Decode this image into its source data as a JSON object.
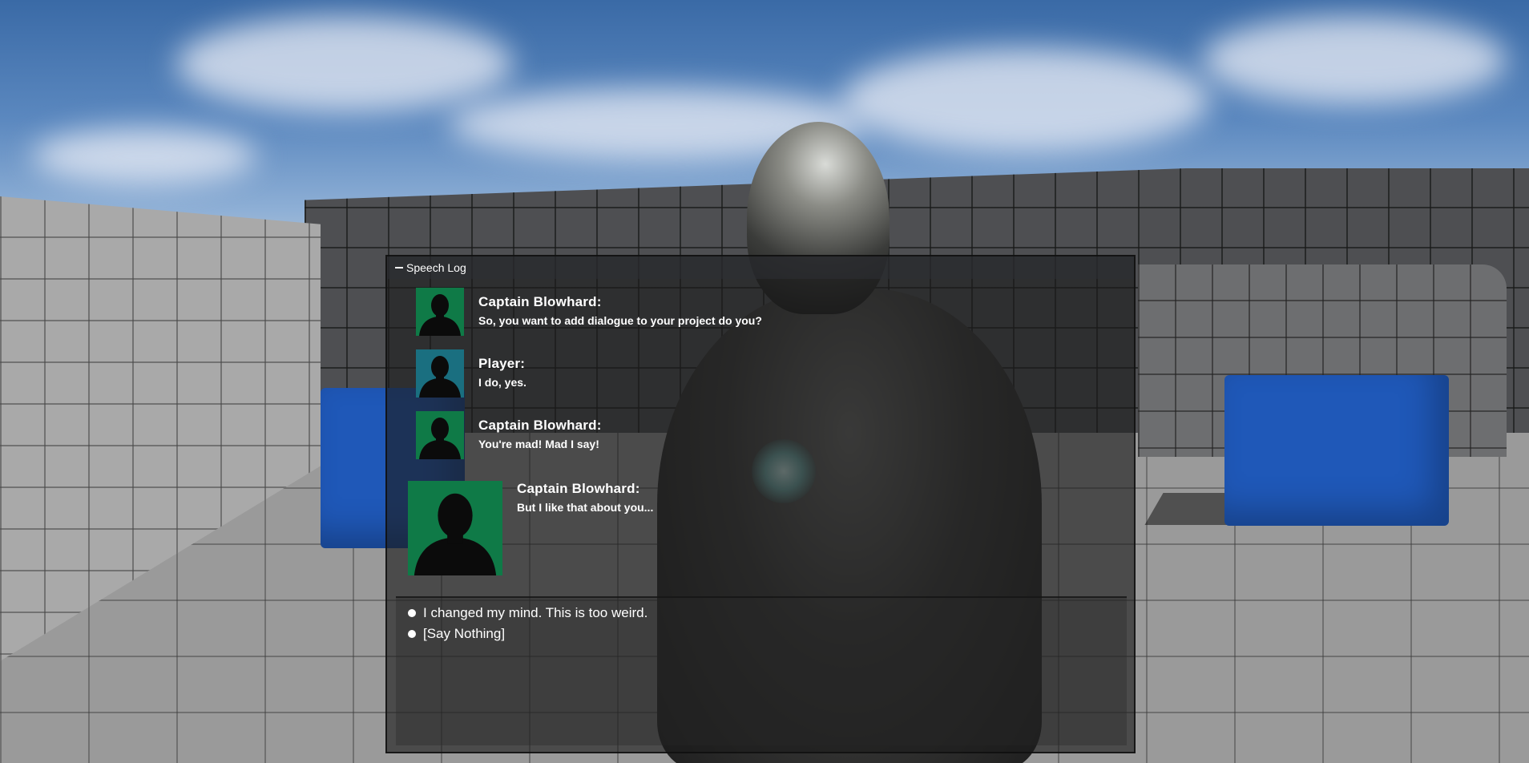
{
  "speech_log": {
    "header_label": "Speech Log",
    "entries": [
      {
        "speaker": "Captain Blowhard:",
        "line": "So, you want to add dialogue to your project do you?",
        "portrait": "silhouette-green-icon"
      },
      {
        "speaker": "Player:",
        "line": "I do, yes.",
        "portrait": "silhouette-teal-icon"
      },
      {
        "speaker": "Captain Blowhard:",
        "line": "You're mad! Mad I say!",
        "portrait": "silhouette-green-icon"
      },
      {
        "speaker": "Captain Blowhard:",
        "line": "But I like that about you...",
        "portrait": "silhouette-green-icon"
      }
    ]
  },
  "choices": [
    {
      "label": "I changed my mind. This is too weird."
    },
    {
      "label": "[Say Nothing]"
    }
  ],
  "colors": {
    "portrait_green": "#0f7a47",
    "portrait_teal": "#1a6f80",
    "panel_bg": "rgba(28,28,28,0.62)"
  }
}
